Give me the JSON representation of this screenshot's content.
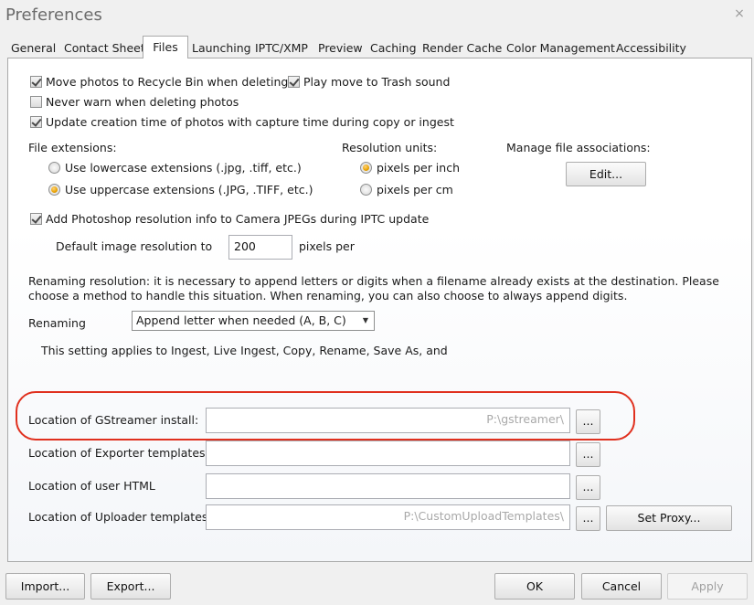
{
  "window": {
    "title": "Preferences",
    "close_icon": "×"
  },
  "tabs": [
    "General",
    "Contact Sheet",
    "Files",
    "Launching",
    "IPTC/XMP",
    "Preview",
    "Caching",
    "Render Cache",
    "Color Management",
    "Accessibility"
  ],
  "active_tab": "Files",
  "checkboxes": {
    "recycle_bin": {
      "label": "Move photos to Recycle Bin when deleting",
      "checked": true
    },
    "trash_sound": {
      "label": "Play move to Trash sound",
      "checked": true
    },
    "never_warn": {
      "label": "Never warn when deleting photos",
      "checked": false
    },
    "update_creation": {
      "label": "Update creation time of photos with capture time during copy or ingest",
      "checked": true
    },
    "photoshop_res": {
      "label": "Add Photoshop resolution info to Camera JPEGs during IPTC update",
      "checked": true
    }
  },
  "file_extensions": {
    "heading": "File extensions:",
    "lowercase": "Use lowercase extensions (.jpg, .tiff, etc.)",
    "uppercase": "Use uppercase extensions (.JPG, .TIFF, etc.)",
    "selected": "uppercase"
  },
  "resolution_units": {
    "heading": "Resolution units:",
    "inch": "pixels per inch",
    "cm": "pixels per cm",
    "selected": "inch"
  },
  "file_associations": {
    "heading": "Manage file associations:",
    "edit_label": "Edit..."
  },
  "default_resolution": {
    "label": "Default image resolution to",
    "value": "200",
    "suffix": "pixels per"
  },
  "renaming": {
    "description_line1": "Renaming resolution: it is necessary to append letters or digits when a filename already exists at the destination.  Please",
    "description_line2": "choose a method to handle this situation.  When renaming, you can also choose to always append digits.",
    "label": "Renaming",
    "selected": "Append letter when needed (A, B, C)",
    "note": "This setting applies to Ingest, Live Ingest, Copy, Rename, Save As, and"
  },
  "locations": {
    "gstreamer": {
      "label": "Location of GStreamer install:",
      "value": "P:\\gstreamer\\"
    },
    "exporter": {
      "label": "Location of Exporter templates:",
      "value": ""
    },
    "user_html": {
      "label": "Location of user HTML",
      "value": ""
    },
    "uploader": {
      "label": "Location of Uploader templates:",
      "value": "P:\\CustomUploadTemplates\\"
    },
    "browse_label": "...",
    "set_proxy_label": "Set Proxy..."
  },
  "footer": {
    "import_label": "Import...",
    "export_label": "Export...",
    "ok_label": "OK",
    "cancel_label": "Cancel",
    "apply_label": "Apply"
  },
  "colors": {
    "highlight": "#e0301e",
    "radio_on": "#e8a200"
  }
}
